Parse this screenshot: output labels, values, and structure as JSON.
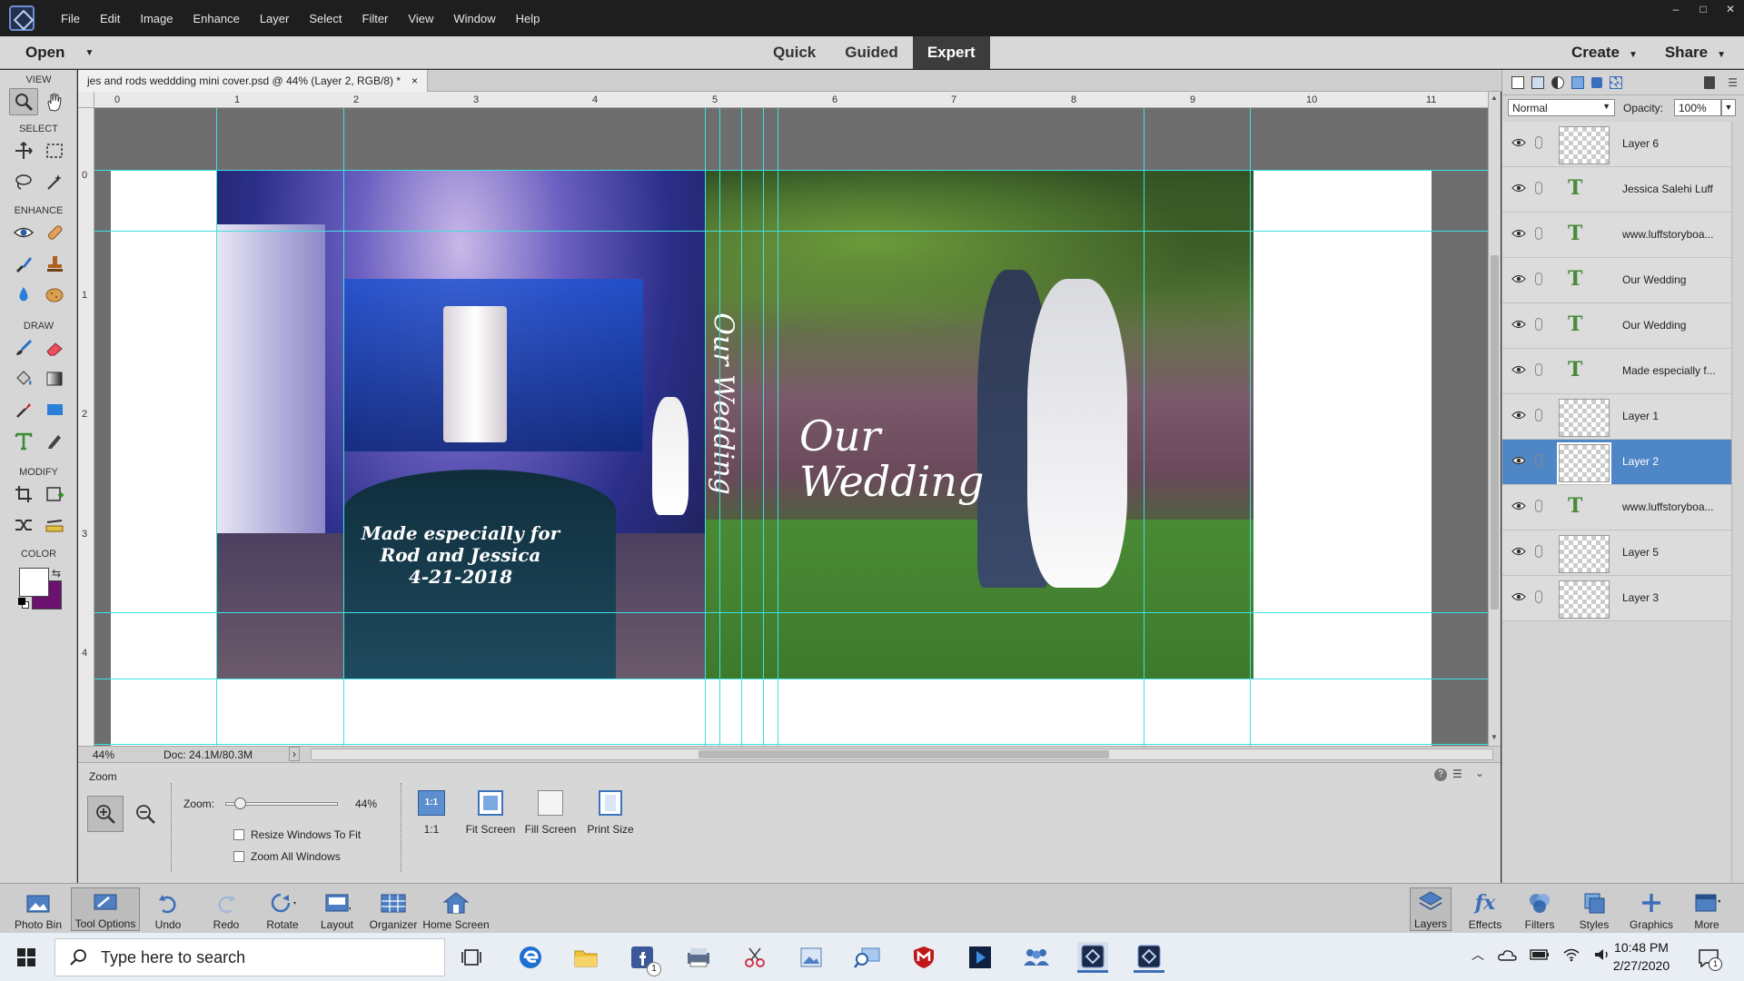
{
  "menu": [
    "File",
    "Edit",
    "Image",
    "Enhance",
    "Layer",
    "Select",
    "Filter",
    "View",
    "Window",
    "Help"
  ],
  "window_controls": [
    "–",
    "□",
    "✕"
  ],
  "modebar": {
    "open_label": "Open",
    "modes": [
      "Quick",
      "Guided",
      "Expert"
    ],
    "active_mode": "Expert",
    "create_label": "Create",
    "share_label": "Share"
  },
  "toolbox": {
    "sections": {
      "view": "VIEW",
      "select": "SELECT",
      "enhance": "ENHANCE",
      "draw": "DRAW",
      "modify": "MODIFY",
      "color": "COLOR"
    },
    "foreground_color": "#ffffff",
    "background_color": "#6b1270"
  },
  "document": {
    "tab_title": "jes and rods weddding mini cover.psd @ 44% (Layer 2, RGB/8) *",
    "close_glyph": "×",
    "ruler_top": [
      "0",
      "1",
      "2",
      "3",
      "4",
      "5",
      "6",
      "7",
      "8",
      "9",
      "10",
      "11"
    ],
    "ruler_left": [
      "0",
      "1",
      "2",
      "3",
      "4"
    ],
    "cover_text": {
      "back_line1": "Made especially for",
      "back_line2": "Rod and Jessica",
      "back_line3": "4-21-2018",
      "spine": "Our Wedding",
      "front_line1": "Our",
      "front_line2": "Wedding"
    }
  },
  "status": {
    "zoom": "44%",
    "doc_size": "Doc: 24.1M/80.3M",
    "arrow": "›"
  },
  "tool_options": {
    "title": "Zoom",
    "zoom_label": "Zoom:",
    "zoom_value": "44%",
    "zoom_slider_value": 0.08,
    "resize_label": "Resize Windows To Fit",
    "zoom_all_label": "Zoom All Windows",
    "buttons": [
      "1:1",
      "Fit Screen",
      "Fill Screen",
      "Print Size"
    ],
    "one_to_one_icon_text": "1:1"
  },
  "layers_panel": {
    "blend_mode": "Normal",
    "opacity_label": "Opacity:",
    "opacity_value": "100%",
    "selected_layer": "Layer 2",
    "layers": [
      {
        "name": "Layer 6",
        "kind": "image"
      },
      {
        "name": "Jessica Salehi Luff",
        "kind": "text"
      },
      {
        "name": "www.luffstoryboa...",
        "kind": "text"
      },
      {
        "name": "Our Wedding",
        "kind": "text"
      },
      {
        "name": "Our Wedding",
        "kind": "text"
      },
      {
        "name": "Made especially f...",
        "kind": "text"
      },
      {
        "name": "Layer 1",
        "kind": "image"
      },
      {
        "name": "Layer 2",
        "kind": "image"
      },
      {
        "name": "www.luffstoryboa...",
        "kind": "text"
      },
      {
        "name": "Layer 5",
        "kind": "image"
      },
      {
        "name": "Layer 3",
        "kind": "image"
      }
    ],
    "text_glyph": "T"
  },
  "app_taskbar": {
    "left": [
      "Photo Bin",
      "Tool Options",
      "Undo",
      "Redo",
      "Rotate",
      "Layout",
      "Organizer",
      "Home Screen"
    ],
    "right": [
      "Layers",
      "Effects",
      "Filters",
      "Styles",
      "Graphics",
      "More"
    ],
    "effects_glyph": "fx"
  },
  "windows_taskbar": {
    "search_placeholder": "Type here to search",
    "time": "10:48 PM",
    "date": "2/27/2020",
    "facebook_badge": "1",
    "notification_count": "1"
  }
}
